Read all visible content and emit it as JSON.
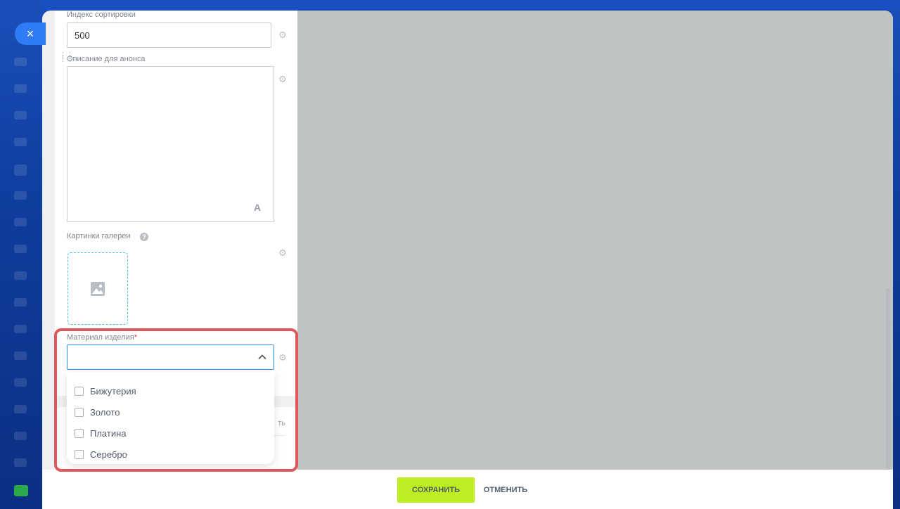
{
  "window": {
    "close_icon": "×"
  },
  "form": {
    "sort_index": {
      "label": "Индекс сортировки",
      "value": "500"
    },
    "preview_description": {
      "label": "Описание для анонса",
      "font_icon": "A"
    },
    "gallery": {
      "label": "Картинки галереи",
      "help": "?"
    },
    "material": {
      "label": "Материал изделия",
      "required_mark": "*",
      "value": "",
      "options": [
        {
          "label": "Бижутерия",
          "checked": false
        },
        {
          "label": "Золото",
          "checked": false
        },
        {
          "label": "Платина",
          "checked": false
        },
        {
          "label": "Серебро",
          "checked": false
        }
      ]
    },
    "lower_card_text": "ть"
  },
  "footer": {
    "save_label": "СОХРАНИТЬ",
    "cancel_label": "ОТМЕНИТЬ"
  },
  "colors": {
    "save_button": "#bbed21",
    "highlight": "#e0575c",
    "select_border": "#2f8ae8",
    "upload_border": "#4cc3e6"
  }
}
